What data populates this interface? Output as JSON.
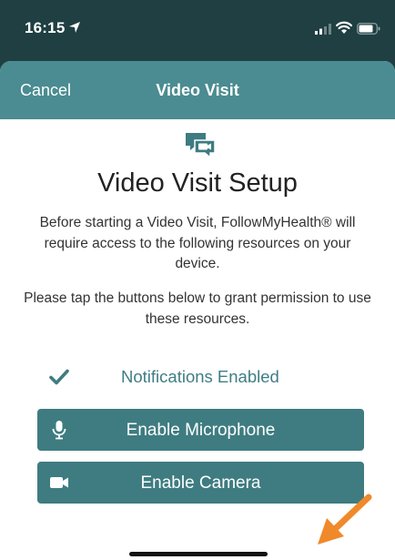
{
  "status_bar": {
    "time": "16:15",
    "icons": [
      "location-arrow-icon",
      "signal-icon",
      "wifi-icon",
      "battery-icon"
    ]
  },
  "nav": {
    "cancel_label": "Cancel",
    "title": "Video Visit"
  },
  "content": {
    "header_icon": "video-chat-icon",
    "title": "Video Visit Setup",
    "intro": "Before starting a Video Visit, FollowMyHealth® will require access to the following resources on your device.",
    "instruction": "Please tap the buttons below to grant permission to use these resources."
  },
  "permissions": {
    "notifications_label": "Notifications Enabled",
    "microphone_label": "Enable Microphone",
    "camera_label": "Enable Camera"
  },
  "colors": {
    "nav_background": "#4a8c91",
    "button_background": "#3e7c81",
    "accent_text": "#3f7e84",
    "status_background": "#1f3f42",
    "arrow_annotation": "#f0892a"
  }
}
